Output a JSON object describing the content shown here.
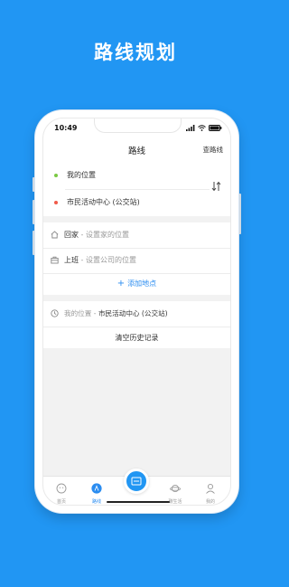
{
  "promo": {
    "title": "路线规划"
  },
  "status_bar": {
    "time": "10:49"
  },
  "nav": {
    "title": "路线",
    "action": "查路线"
  },
  "route": {
    "origin": "我的位置",
    "destination": "市民活动中心 (公交站)",
    "origin_color": "#7ac943",
    "destination_color": "#f05a4a"
  },
  "favorites": {
    "items": [
      {
        "label": "回家",
        "separator": " - ",
        "desc": "设置家的位置",
        "icon": "home-icon"
      },
      {
        "label": "上班",
        "separator": " - ",
        "desc": "设置公司的位置",
        "icon": "briefcase-icon"
      }
    ],
    "add_label": "添加地点"
  },
  "history": {
    "from": "我的位置",
    "separator": " - ",
    "to": "市民活动中心 (公交站)",
    "clear_label": "清空历史记录"
  },
  "tabs": [
    {
      "label": "首页",
      "icon": "home-face-icon"
    },
    {
      "label": "路线",
      "icon": "route-icon"
    },
    {
      "label": "",
      "icon": "bus-card-icon"
    },
    {
      "label": "碳生活",
      "icon": "planet-icon"
    },
    {
      "label": "我的",
      "icon": "user-icon"
    }
  ],
  "colors": {
    "brand": "#2196f3",
    "accent": "#2a8cf0"
  }
}
